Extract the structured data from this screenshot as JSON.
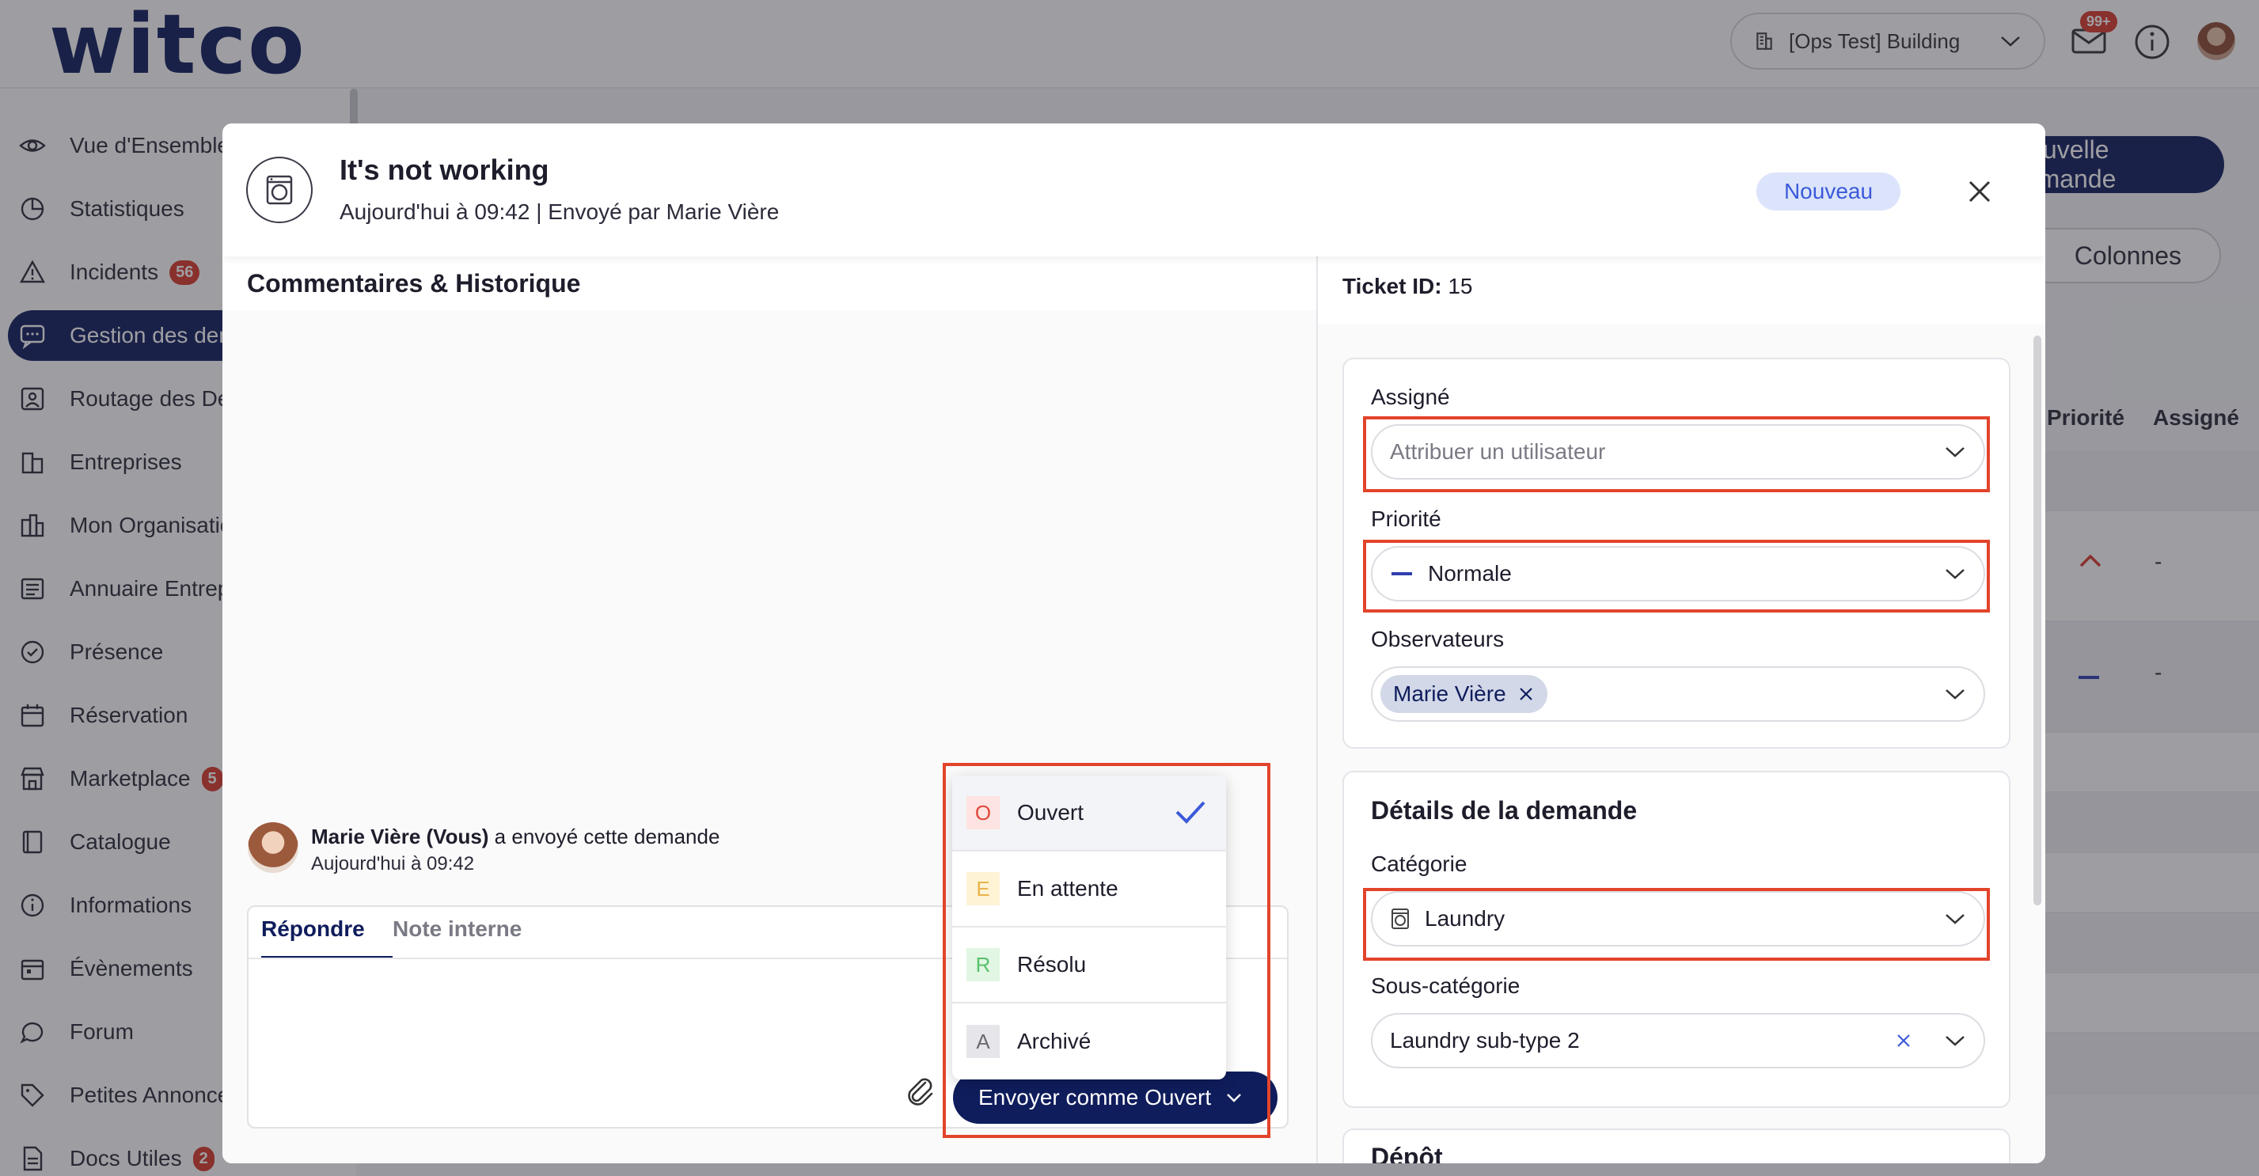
{
  "app": {
    "logo": "witco",
    "building": "[Ops Test] Building",
    "mail_badge": "99+"
  },
  "sidebar": {
    "items": [
      {
        "label": "Vue d'Ensemble",
        "icon": "eye-icon"
      },
      {
        "label": "Statistiques",
        "icon": "pie-chart-icon"
      },
      {
        "label": "Incidents",
        "icon": "warning-icon",
        "badge": "56"
      },
      {
        "label": "Gestion des demandes",
        "icon": "chat-icon",
        "active": true
      },
      {
        "label": "Routage des Demandes",
        "icon": "routing-icon"
      },
      {
        "label": "Entreprises",
        "icon": "buildings-icon"
      },
      {
        "label": "Mon Organisation",
        "icon": "organization-icon"
      },
      {
        "label": "Annuaire Entreprises",
        "icon": "directory-icon"
      },
      {
        "label": "Présence",
        "icon": "check-circle-icon"
      },
      {
        "label": "Réservation",
        "icon": "calendar-icon"
      },
      {
        "label": "Marketplace",
        "icon": "store-icon",
        "badge": "5"
      },
      {
        "label": "Catalogue",
        "icon": "book-icon"
      },
      {
        "label": "Informations",
        "icon": "info-icon"
      },
      {
        "label": "Évènements",
        "icon": "event-calendar-icon"
      },
      {
        "label": "Forum",
        "icon": "speech-bubble-icon"
      },
      {
        "label": "Petites Annonces",
        "icon": "tag-icon"
      },
      {
        "label": "Docs Utiles",
        "icon": "document-icon",
        "badge": "2"
      }
    ]
  },
  "background_page": {
    "new_request_button": "Nouvelle demande",
    "columns_button": "Colonnes",
    "headers": [
      "Priorité",
      "Assigné"
    ],
    "rows": [
      {
        "assignee": "-"
      },
      {
        "assignee": "-"
      }
    ]
  },
  "modal": {
    "title": "It's not working",
    "subtitle": "Aujourd'hui à 09:42 | Envoyé par Marie Vière",
    "status": "Nouveau",
    "comments_title": "Commentaires & Historique",
    "event": {
      "sender": "Marie Vière (Vous)",
      "action": " a envoyé cette demande",
      "time": "Aujourd'hui à 09:42"
    },
    "tabs": [
      "Répondre",
      "Note interne"
    ],
    "send_button": "Envoyer comme Ouvert",
    "status_options": [
      {
        "letter": "O",
        "label": "Ouvert",
        "bg": "#fde3e1",
        "fg": "#e0483a",
        "selected": true
      },
      {
        "letter": "E",
        "label": "En attente",
        "bg": "#fff3d6",
        "fg": "#e9b44a",
        "selected": false
      },
      {
        "letter": "R",
        "label": "Résolu",
        "bg": "#e1f6e3",
        "fg": "#58c26a",
        "selected": false
      },
      {
        "letter": "A",
        "label": "Archivé",
        "bg": "#e6e6ea",
        "fg": "#6b6b74",
        "selected": false
      }
    ]
  },
  "details": {
    "ticket_id_label": "Ticket ID:",
    "ticket_id": "15",
    "assignee_label": "Assigné",
    "assignee_placeholder": "Attribuer un utilisateur",
    "priority_label": "Priorité",
    "priority_value": "Normale",
    "observers_label": "Observateurs",
    "observer_chip": "Marie Vière",
    "request_details_title": "Détails de la demande",
    "category_label": "Catégorie",
    "category_value": "Laundry",
    "subcategory_label": "Sous-catégorie",
    "subcategory_value": "Laundry sub-type 2",
    "next_section_title": "Dépôt"
  },
  "colors": {
    "brand_navy": "#0f1d5c",
    "highlight_red": "#e2442b",
    "status_blue": "#3a5ad9",
    "badge_red": "#d93a2b"
  }
}
